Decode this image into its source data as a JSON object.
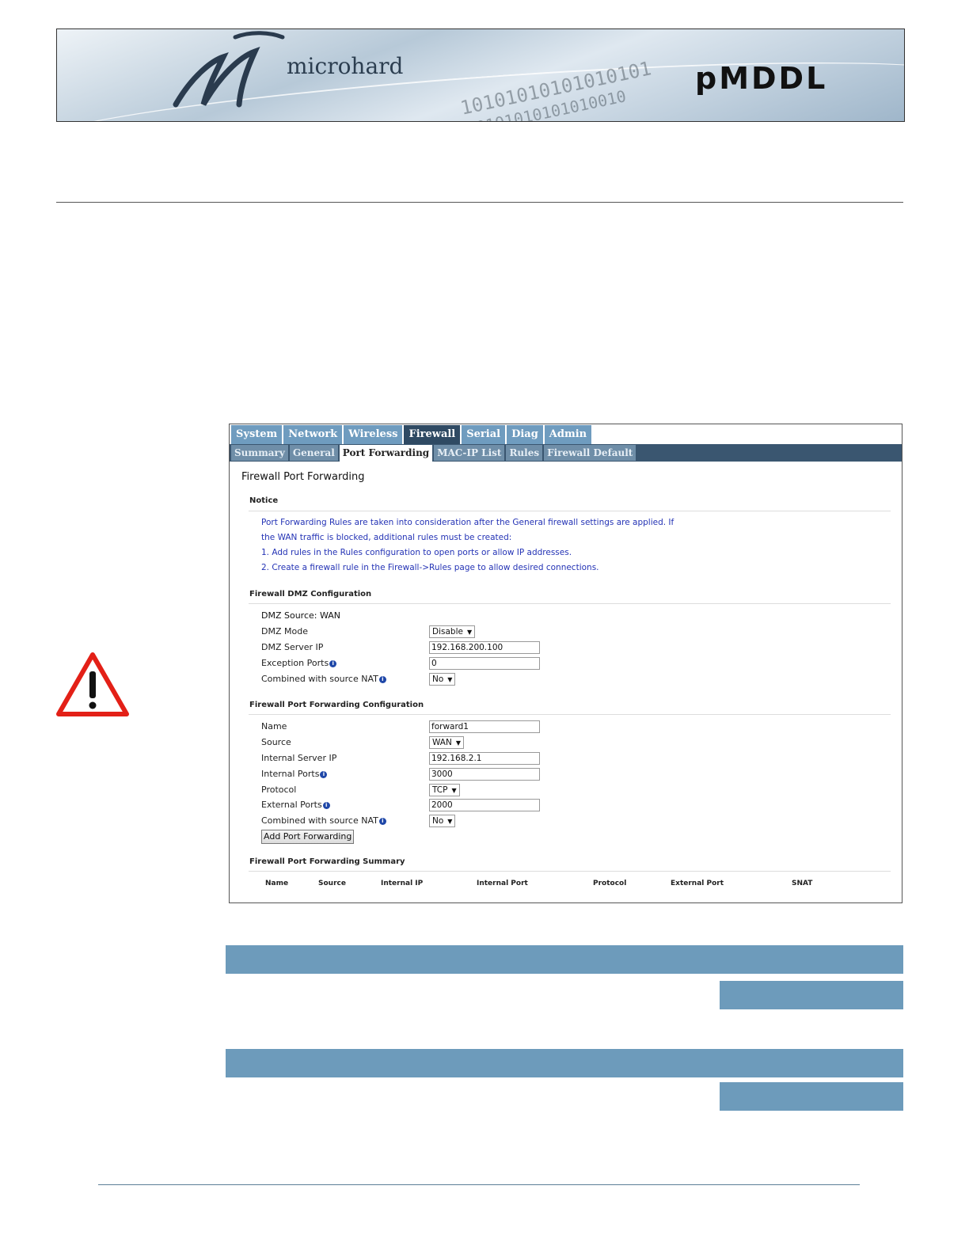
{
  "banner": {
    "brand": "microhard",
    "product": "pMDDL",
    "binary_top": "10101010101010101",
    "binary_bottom": "0101010101010010"
  },
  "main_tabs": [
    "System",
    "Network",
    "Wireless",
    "Firewall",
    "Serial",
    "Diag",
    "Admin"
  ],
  "main_tab_active": "Firewall",
  "sub_tabs": [
    "Summary",
    "General",
    "Port Forwarding",
    "MAC-IP List",
    "Rules",
    "Firewall Default"
  ],
  "sub_tab_active": "Port Forwarding",
  "page_title": "Firewall Port Forwarding",
  "notice": {
    "heading": "Notice",
    "lines": [
      "Port Forwarding Rules are taken into consideration after the General firewall settings are applied. If",
      "the WAN traffic is blocked, additional rules must be created:",
      "1. Add rules in the Rules configuration to open ports or allow IP addresses.",
      "2. Create a firewall rule in the Firewall->Rules page to allow desired connections."
    ]
  },
  "dmz": {
    "heading": "Firewall DMZ Configuration",
    "source_label": "DMZ Source: WAN",
    "mode_label": "DMZ Mode",
    "mode_value": "Disable",
    "server_ip_label": "DMZ Server IP",
    "server_ip_value": "192.168.200.100",
    "exception_ports_label": "Exception Ports",
    "exception_ports_value": "0",
    "snat_label": "Combined with source NAT",
    "snat_value": "No"
  },
  "pf": {
    "heading": "Firewall Port Forwarding Configuration",
    "name_label": "Name",
    "name_value": "forward1",
    "source_label": "Source",
    "source_value": "WAN",
    "internal_ip_label": "Internal Server IP",
    "internal_ip_value": "192.168.2.1",
    "internal_ports_label": "Internal Ports",
    "internal_ports_value": "3000",
    "protocol_label": "Protocol",
    "protocol_value": "TCP",
    "external_ports_label": "External Ports",
    "external_ports_value": "2000",
    "snat_label": "Combined with source NAT",
    "snat_value": "No",
    "add_button": "Add Port Forwarding"
  },
  "summary": {
    "heading": "Firewall Port Forwarding Summary",
    "columns": [
      "Name",
      "Source",
      "Internal IP",
      "Internal Port",
      "Protocol",
      "External Port",
      "SNAT"
    ]
  },
  "colors": {
    "tab_blue": "#6f9cbf",
    "tab_active": "#2f4a63",
    "subbar": "#3a5670",
    "notice_text": "#2433b5",
    "table_bar": "#6d9bbb",
    "warning_red": "#e32017"
  },
  "icons": {
    "warning": "warning-triangle-icon",
    "info": "info-icon",
    "dropdown": "chevron-down-icon"
  }
}
